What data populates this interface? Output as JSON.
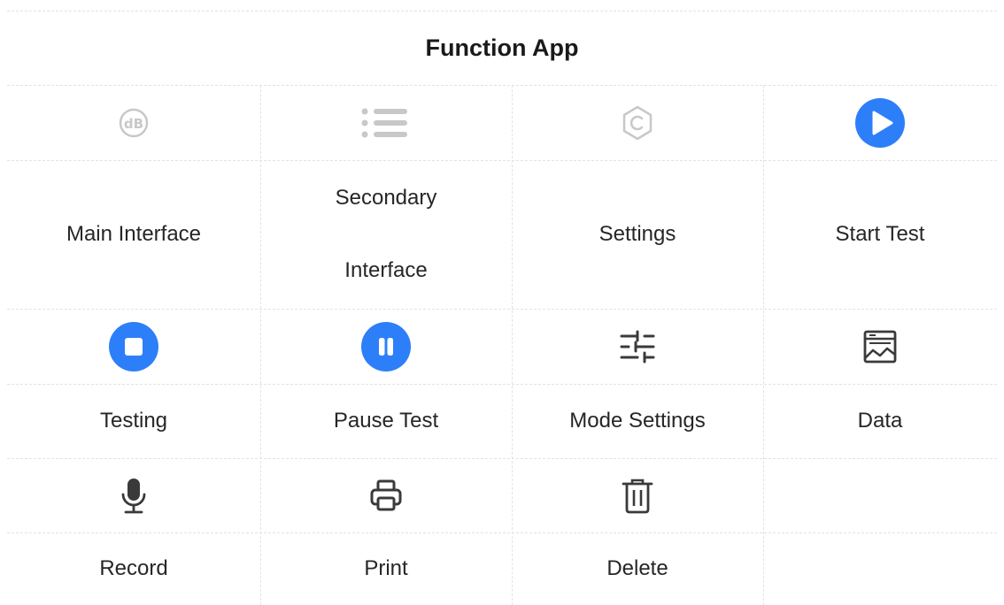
{
  "page": {
    "title": "Function App"
  },
  "grid": {
    "rows": [
      {
        "icons": [
          "db-icon",
          "list-icon",
          "settings-icon",
          "play-icon"
        ],
        "labels": [
          "Main Interface",
          "Secondary Interface",
          "Settings",
          "Start Test"
        ]
      },
      {
        "icons": [
          "stop-icon",
          "pause-icon",
          "sliders-icon",
          "data-chart-icon"
        ],
        "labels": [
          "Testing",
          "Pause Test",
          "Mode Settings",
          "Data"
        ]
      },
      {
        "icons": [
          "microphone-icon",
          "printer-icon",
          "trash-icon",
          ""
        ],
        "labels": [
          "Record",
          "Print",
          "Delete",
          ""
        ]
      }
    ],
    "secondary_lines": [
      "Secondary",
      "Interface"
    ]
  },
  "colors": {
    "accent": "#2d7ff9",
    "icon_dark": "#3a3a3a",
    "icon_light": "#c8c8c8",
    "grid_line": "#e3e3e3"
  }
}
